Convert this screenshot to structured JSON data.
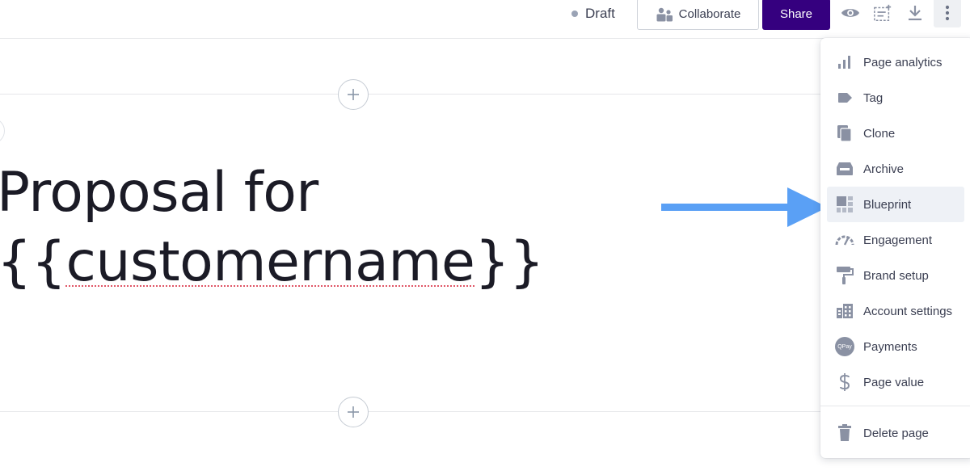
{
  "header": {
    "status_label": "Draft",
    "collaborate_label": "Collaborate",
    "share_label": "Share",
    "share_color": "#35007f",
    "icons": [
      "eye-icon",
      "variables-icon",
      "download-icon",
      "more-vertical-icon"
    ]
  },
  "document": {
    "title_line1": "Proposal for",
    "title_line2_open": "{{",
    "title_line2_var": "customername",
    "title_line2_close": "}}"
  },
  "menu": {
    "items": [
      {
        "label": "Page analytics",
        "icon": "bar-chart-icon"
      },
      {
        "label": "Tag",
        "icon": "tag-icon"
      },
      {
        "label": "Clone",
        "icon": "clone-icon"
      },
      {
        "label": "Archive",
        "icon": "archive-icon"
      },
      {
        "label": "Blueprint",
        "icon": "blueprint-icon",
        "active": true
      },
      {
        "label": "Engagement",
        "icon": "gauge-icon"
      },
      {
        "label": "Brand setup",
        "icon": "paint-roller-icon"
      },
      {
        "label": "Account settings",
        "icon": "building-icon"
      },
      {
        "label": "Payments",
        "icon": "qpay-icon",
        "icon_text": "QPay"
      },
      {
        "label": "Page value",
        "icon": "dollar-icon"
      }
    ],
    "delete_label": "Delete page",
    "delete_icon": "trash-icon"
  },
  "colors": {
    "icon_gray": "#8a91a3",
    "arrow_blue": "#5aa0f5",
    "active_bg": "#eef1f6"
  }
}
